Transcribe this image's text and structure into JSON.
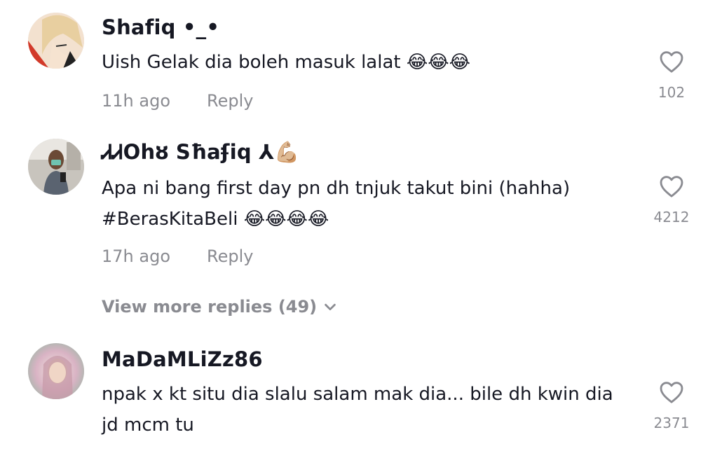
{
  "comments": [
    {
      "username": "Shafiq •_•",
      "text": "Uish Gelak dia boleh masuk lalat 😂😂😂",
      "time": "11h ago",
      "reply_label": "Reply",
      "likes": "102"
    },
    {
      "username": "ᏗᏗOhȣ Sħaʄiq ⅄💪🏼",
      "text": "Apa ni bang first day pn dh tnjuk takut bini (hahha) #BerasKitaBeli 😂😂😂😂",
      "time": "17h ago",
      "reply_label": "Reply",
      "likes": "4212"
    },
    {
      "username": "MaDaMLiZz86",
      "text": "npak x kt situ dia slalu salam mak dia... bile dh kwin dia jd mcm tu",
      "likes": "2371"
    }
  ],
  "view_more_replies": "View more replies (49)",
  "icons": {
    "like": "heart-outline-icon",
    "expand": "chevron-down-icon"
  },
  "colors": {
    "text_primary": "#161823",
    "text_secondary": "#8a8b91"
  }
}
